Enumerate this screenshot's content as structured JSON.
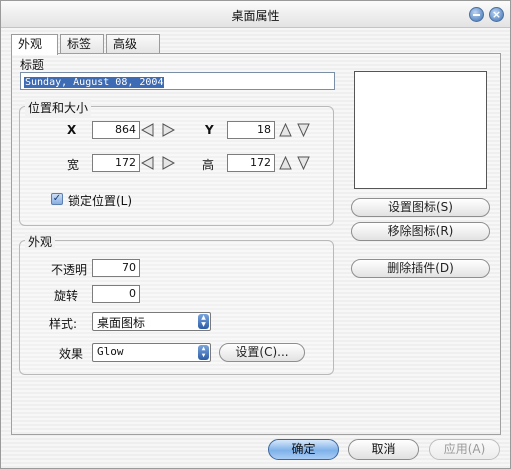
{
  "window": {
    "title": "桌面属性"
  },
  "tabs": [
    {
      "label": "外观",
      "active": true
    },
    {
      "label": "标签",
      "active": false
    },
    {
      "label": "高级",
      "active": false
    }
  ],
  "title_section": {
    "label": "标题",
    "value": "Sunday, August 08, 2004"
  },
  "position_size": {
    "group_label": "位置和大小",
    "x_label": "X",
    "x_value": "864",
    "y_label": "Y",
    "y_value": "18",
    "width_label": "宽",
    "width_value": "172",
    "height_label": "高",
    "height_value": "172",
    "lock_label": "锁定位置(L)",
    "lock_checked": true
  },
  "appearance": {
    "group_label": "外观",
    "opacity_label": "不透明",
    "opacity_value": "70",
    "rotate_label": "旋转",
    "rotate_value": "0",
    "style_label": "样式:",
    "style_value": "桌面图标",
    "effect_label": "效果",
    "effect_value": "Glow",
    "settings_button": "设置(C)..."
  },
  "icon_buttons": {
    "set_icon": "设置图标(S)",
    "remove_icon": "移除图标(R)",
    "delete_widget": "删除插件(D)"
  },
  "footer": {
    "ok": "确定",
    "cancel": "取消",
    "apply": "应用(A)"
  },
  "colors": {
    "selection": "#3d6bb4",
    "default_button": "#7fb1ea"
  },
  "icons": [
    "minimize-icon",
    "close-icon",
    "left-arrow-icon",
    "right-arrow-icon",
    "up-arrow-icon",
    "down-arrow-icon",
    "checkbox-checked-icon",
    "dropdown-stepper-icon"
  ]
}
